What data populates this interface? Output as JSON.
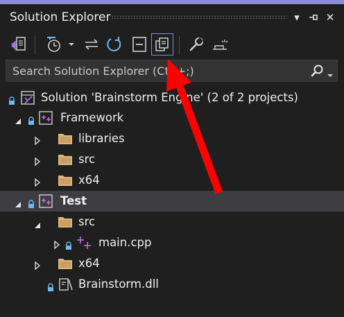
{
  "panel": {
    "title": "Solution Explorer",
    "dropdown_glyph": "▾",
    "pin_glyph": "⊣",
    "close_glyph": "✕"
  },
  "toolbar": {
    "icons": [
      "vs-switch-views-icon",
      "history-icon",
      "dropdown-icon",
      "sync-icon",
      "refresh-icon",
      "collapse-all-icon",
      "show-all-files-icon",
      "properties-wrench-icon",
      "preview-icon"
    ],
    "active_icon": "show-all-files-icon"
  },
  "search": {
    "placeholder": "Search Solution Explorer (Ctrl+;)",
    "icon": "search-icon"
  },
  "tree": {
    "solution": "Solution 'Brainstorm Engine' (2 of 2 projects)",
    "framework": "Framework",
    "framework_children": [
      "libraries",
      "src",
      "x64"
    ],
    "test": "Test",
    "test_src": "src",
    "main_cpp": "main.cpp",
    "test_x64": "x64",
    "dll": "Brainstorm.dll"
  },
  "colors": {
    "background": "#1f1f1f",
    "accent": "#8b8bd8",
    "folder": "#dcb67a",
    "selection": "#3e3e42",
    "arrow": "#ff0000"
  }
}
